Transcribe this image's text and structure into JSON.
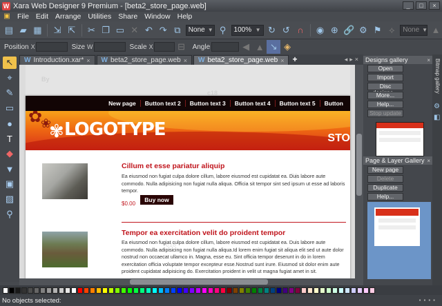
{
  "window": {
    "title": "Xara Web Designer 9 Premium - [beta2_store_page.web]",
    "app_glyph": "W",
    "controls": [
      "_",
      "□",
      "×"
    ]
  },
  "menu": [
    "File",
    "Edit",
    "Arrange",
    "Utilities",
    "Share",
    "Window",
    "Help"
  ],
  "toolbar": {
    "quality": "None",
    "zoom": "100%",
    "feather": "None"
  },
  "props": {
    "position": "Position",
    "size": "Size",
    "scale": "Scale",
    "angle": "Angle",
    "x": "X",
    "y": "Y",
    "w": "W",
    "h": "H"
  },
  "tabs": [
    {
      "label": "Introduction.xar*",
      "active": false
    },
    {
      "label": "beta2_store_page.web",
      "active": false
    },
    {
      "label": "beta2_store_page.web",
      "active": true
    }
  ],
  "site": {
    "nav": [
      "New page",
      "Button text 2",
      "Button text 3",
      "Button text 4",
      "Button text 5",
      "Button"
    ],
    "logo": "LOGOTYPE",
    "banner_right": "STO",
    "item1": {
      "title": "Cillum et esse pariatur aliquip",
      "body": "Ea eiusmod non fugiat culpa dolore cillum, labore eiusmod est cupidatat ea. Duis labore aute commodo. Nulla adipisicing non fugiat nulla aliqua. Officia sit tempor sint sed ipsum ut esse ad laboris tempor.",
      "price": "$0.00",
      "button": "Buy now"
    },
    "item2": {
      "title": "Tempor ea exercitation velit do proident tempor",
      "body": "Ea eiusmod non fugiat culpa dolore cillum, labore eiusmod est cupidatat ea. Duis labore aute commodo. Nulla adipisicing non fugiat nulla aliqua.Id lorem enim fugiat sit aliqua elit sed ut aute dolor nostrud non occaecat ullamco in. Magna, esse eu. Sint officia tempor deserunt in do in lorem exercitation officia voluptate tempor excepteur esse.Nostrud sunt irure. Eiusmod sit dolor enim aute proident cupidatat adipisicing do. Exercitation proident in velit ut magna fugiat amet in sit."
    }
  },
  "designs_gallery": {
    "title": "Designs gallery",
    "buttons": [
      "Open",
      "Import",
      "Disc designs...",
      "More...",
      "Help...",
      "Stop update"
    ]
  },
  "page_layer_gallery": {
    "title": "Page & Layer Gallery",
    "buttons": [
      "New page",
      "Delete",
      "Duplicate",
      "Help..."
    ]
  },
  "side_tabs": [
    "Bitmap gallery"
  ],
  "status": "No objects selected:",
  "palette": [
    "#ffffff",
    "#000000",
    "#1a1a1a",
    "#333333",
    "#4d4d4d",
    "#666666",
    "#808080",
    "#999999",
    "#b3b3b3",
    "#cccccc",
    "#e6e6e6",
    "#ffffff",
    "#ff0000",
    "#ff4000",
    "#ff8000",
    "#ffbf00",
    "#ffff00",
    "#bfff00",
    "#80ff00",
    "#40ff00",
    "#00ff00",
    "#00ff40",
    "#00ff80",
    "#00ffbf",
    "#00ffff",
    "#00bfff",
    "#0080ff",
    "#0040ff",
    "#0000ff",
    "#4000ff",
    "#8000ff",
    "#bf00ff",
    "#ff00ff",
    "#ff00bf",
    "#ff0080",
    "#ff0040",
    "#800000",
    "#804000",
    "#808000",
    "#408000",
    "#008000",
    "#008040",
    "#008080",
    "#004080",
    "#000080",
    "#400080",
    "#800080",
    "#800040",
    "#ffcccc",
    "#ffe5cc",
    "#ffffcc",
    "#e5ffcc",
    "#ccffcc",
    "#ccffe5",
    "#ccffff",
    "#cce5ff",
    "#ccccff",
    "#e5ccff",
    "#ffccff",
    "#ffcce5"
  ]
}
